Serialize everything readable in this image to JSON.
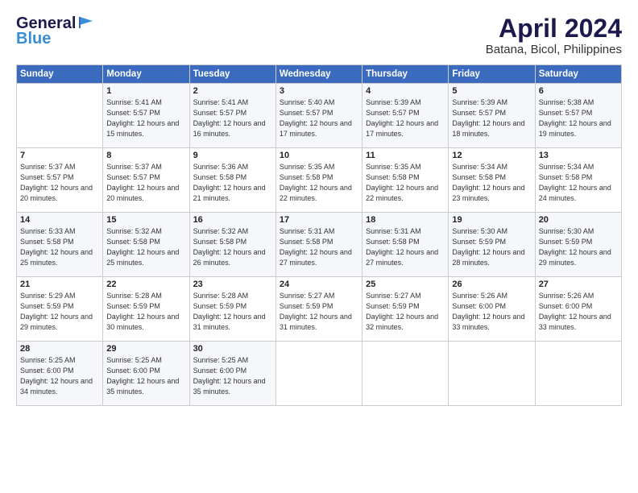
{
  "header": {
    "logo_general": "General",
    "logo_blue": "Blue",
    "month_title": "April 2024",
    "location": "Batana, Bicol, Philippines"
  },
  "days_of_week": [
    "Sunday",
    "Monday",
    "Tuesday",
    "Wednesday",
    "Thursday",
    "Friday",
    "Saturday"
  ],
  "weeks": [
    [
      {
        "day": "",
        "sunrise": "",
        "sunset": "",
        "daylight": ""
      },
      {
        "day": "1",
        "sunrise": "Sunrise: 5:41 AM",
        "sunset": "Sunset: 5:57 PM",
        "daylight": "Daylight: 12 hours and 15 minutes."
      },
      {
        "day": "2",
        "sunrise": "Sunrise: 5:41 AM",
        "sunset": "Sunset: 5:57 PM",
        "daylight": "Daylight: 12 hours and 16 minutes."
      },
      {
        "day": "3",
        "sunrise": "Sunrise: 5:40 AM",
        "sunset": "Sunset: 5:57 PM",
        "daylight": "Daylight: 12 hours and 17 minutes."
      },
      {
        "day": "4",
        "sunrise": "Sunrise: 5:39 AM",
        "sunset": "Sunset: 5:57 PM",
        "daylight": "Daylight: 12 hours and 17 minutes."
      },
      {
        "day": "5",
        "sunrise": "Sunrise: 5:39 AM",
        "sunset": "Sunset: 5:57 PM",
        "daylight": "Daylight: 12 hours and 18 minutes."
      },
      {
        "day": "6",
        "sunrise": "Sunrise: 5:38 AM",
        "sunset": "Sunset: 5:57 PM",
        "daylight": "Daylight: 12 hours and 19 minutes."
      }
    ],
    [
      {
        "day": "7",
        "sunrise": "Sunrise: 5:37 AM",
        "sunset": "Sunset: 5:57 PM",
        "daylight": "Daylight: 12 hours and 20 minutes."
      },
      {
        "day": "8",
        "sunrise": "Sunrise: 5:37 AM",
        "sunset": "Sunset: 5:57 PM",
        "daylight": "Daylight: 12 hours and 20 minutes."
      },
      {
        "day": "9",
        "sunrise": "Sunrise: 5:36 AM",
        "sunset": "Sunset: 5:58 PM",
        "daylight": "Daylight: 12 hours and 21 minutes."
      },
      {
        "day": "10",
        "sunrise": "Sunrise: 5:35 AM",
        "sunset": "Sunset: 5:58 PM",
        "daylight": "Daylight: 12 hours and 22 minutes."
      },
      {
        "day": "11",
        "sunrise": "Sunrise: 5:35 AM",
        "sunset": "Sunset: 5:58 PM",
        "daylight": "Daylight: 12 hours and 22 minutes."
      },
      {
        "day": "12",
        "sunrise": "Sunrise: 5:34 AM",
        "sunset": "Sunset: 5:58 PM",
        "daylight": "Daylight: 12 hours and 23 minutes."
      },
      {
        "day": "13",
        "sunrise": "Sunrise: 5:34 AM",
        "sunset": "Sunset: 5:58 PM",
        "daylight": "Daylight: 12 hours and 24 minutes."
      }
    ],
    [
      {
        "day": "14",
        "sunrise": "Sunrise: 5:33 AM",
        "sunset": "Sunset: 5:58 PM",
        "daylight": "Daylight: 12 hours and 25 minutes."
      },
      {
        "day": "15",
        "sunrise": "Sunrise: 5:32 AM",
        "sunset": "Sunset: 5:58 PM",
        "daylight": "Daylight: 12 hours and 25 minutes."
      },
      {
        "day": "16",
        "sunrise": "Sunrise: 5:32 AM",
        "sunset": "Sunset: 5:58 PM",
        "daylight": "Daylight: 12 hours and 26 minutes."
      },
      {
        "day": "17",
        "sunrise": "Sunrise: 5:31 AM",
        "sunset": "Sunset: 5:58 PM",
        "daylight": "Daylight: 12 hours and 27 minutes."
      },
      {
        "day": "18",
        "sunrise": "Sunrise: 5:31 AM",
        "sunset": "Sunset: 5:58 PM",
        "daylight": "Daylight: 12 hours and 27 minutes."
      },
      {
        "day": "19",
        "sunrise": "Sunrise: 5:30 AM",
        "sunset": "Sunset: 5:59 PM",
        "daylight": "Daylight: 12 hours and 28 minutes."
      },
      {
        "day": "20",
        "sunrise": "Sunrise: 5:30 AM",
        "sunset": "Sunset: 5:59 PM",
        "daylight": "Daylight: 12 hours and 29 minutes."
      }
    ],
    [
      {
        "day": "21",
        "sunrise": "Sunrise: 5:29 AM",
        "sunset": "Sunset: 5:59 PM",
        "daylight": "Daylight: 12 hours and 29 minutes."
      },
      {
        "day": "22",
        "sunrise": "Sunrise: 5:28 AM",
        "sunset": "Sunset: 5:59 PM",
        "daylight": "Daylight: 12 hours and 30 minutes."
      },
      {
        "day": "23",
        "sunrise": "Sunrise: 5:28 AM",
        "sunset": "Sunset: 5:59 PM",
        "daylight": "Daylight: 12 hours and 31 minutes."
      },
      {
        "day": "24",
        "sunrise": "Sunrise: 5:27 AM",
        "sunset": "Sunset: 5:59 PM",
        "daylight": "Daylight: 12 hours and 31 minutes."
      },
      {
        "day": "25",
        "sunrise": "Sunrise: 5:27 AM",
        "sunset": "Sunset: 5:59 PM",
        "daylight": "Daylight: 12 hours and 32 minutes."
      },
      {
        "day": "26",
        "sunrise": "Sunrise: 5:26 AM",
        "sunset": "Sunset: 6:00 PM",
        "daylight": "Daylight: 12 hours and 33 minutes."
      },
      {
        "day": "27",
        "sunrise": "Sunrise: 5:26 AM",
        "sunset": "Sunset: 6:00 PM",
        "daylight": "Daylight: 12 hours and 33 minutes."
      }
    ],
    [
      {
        "day": "28",
        "sunrise": "Sunrise: 5:25 AM",
        "sunset": "Sunset: 6:00 PM",
        "daylight": "Daylight: 12 hours and 34 minutes."
      },
      {
        "day": "29",
        "sunrise": "Sunrise: 5:25 AM",
        "sunset": "Sunset: 6:00 PM",
        "daylight": "Daylight: 12 hours and 35 minutes."
      },
      {
        "day": "30",
        "sunrise": "Sunrise: 5:25 AM",
        "sunset": "Sunset: 6:00 PM",
        "daylight": "Daylight: 12 hours and 35 minutes."
      },
      {
        "day": "",
        "sunrise": "",
        "sunset": "",
        "daylight": ""
      },
      {
        "day": "",
        "sunrise": "",
        "sunset": "",
        "daylight": ""
      },
      {
        "day": "",
        "sunrise": "",
        "sunset": "",
        "daylight": ""
      },
      {
        "day": "",
        "sunrise": "",
        "sunset": "",
        "daylight": ""
      }
    ]
  ]
}
